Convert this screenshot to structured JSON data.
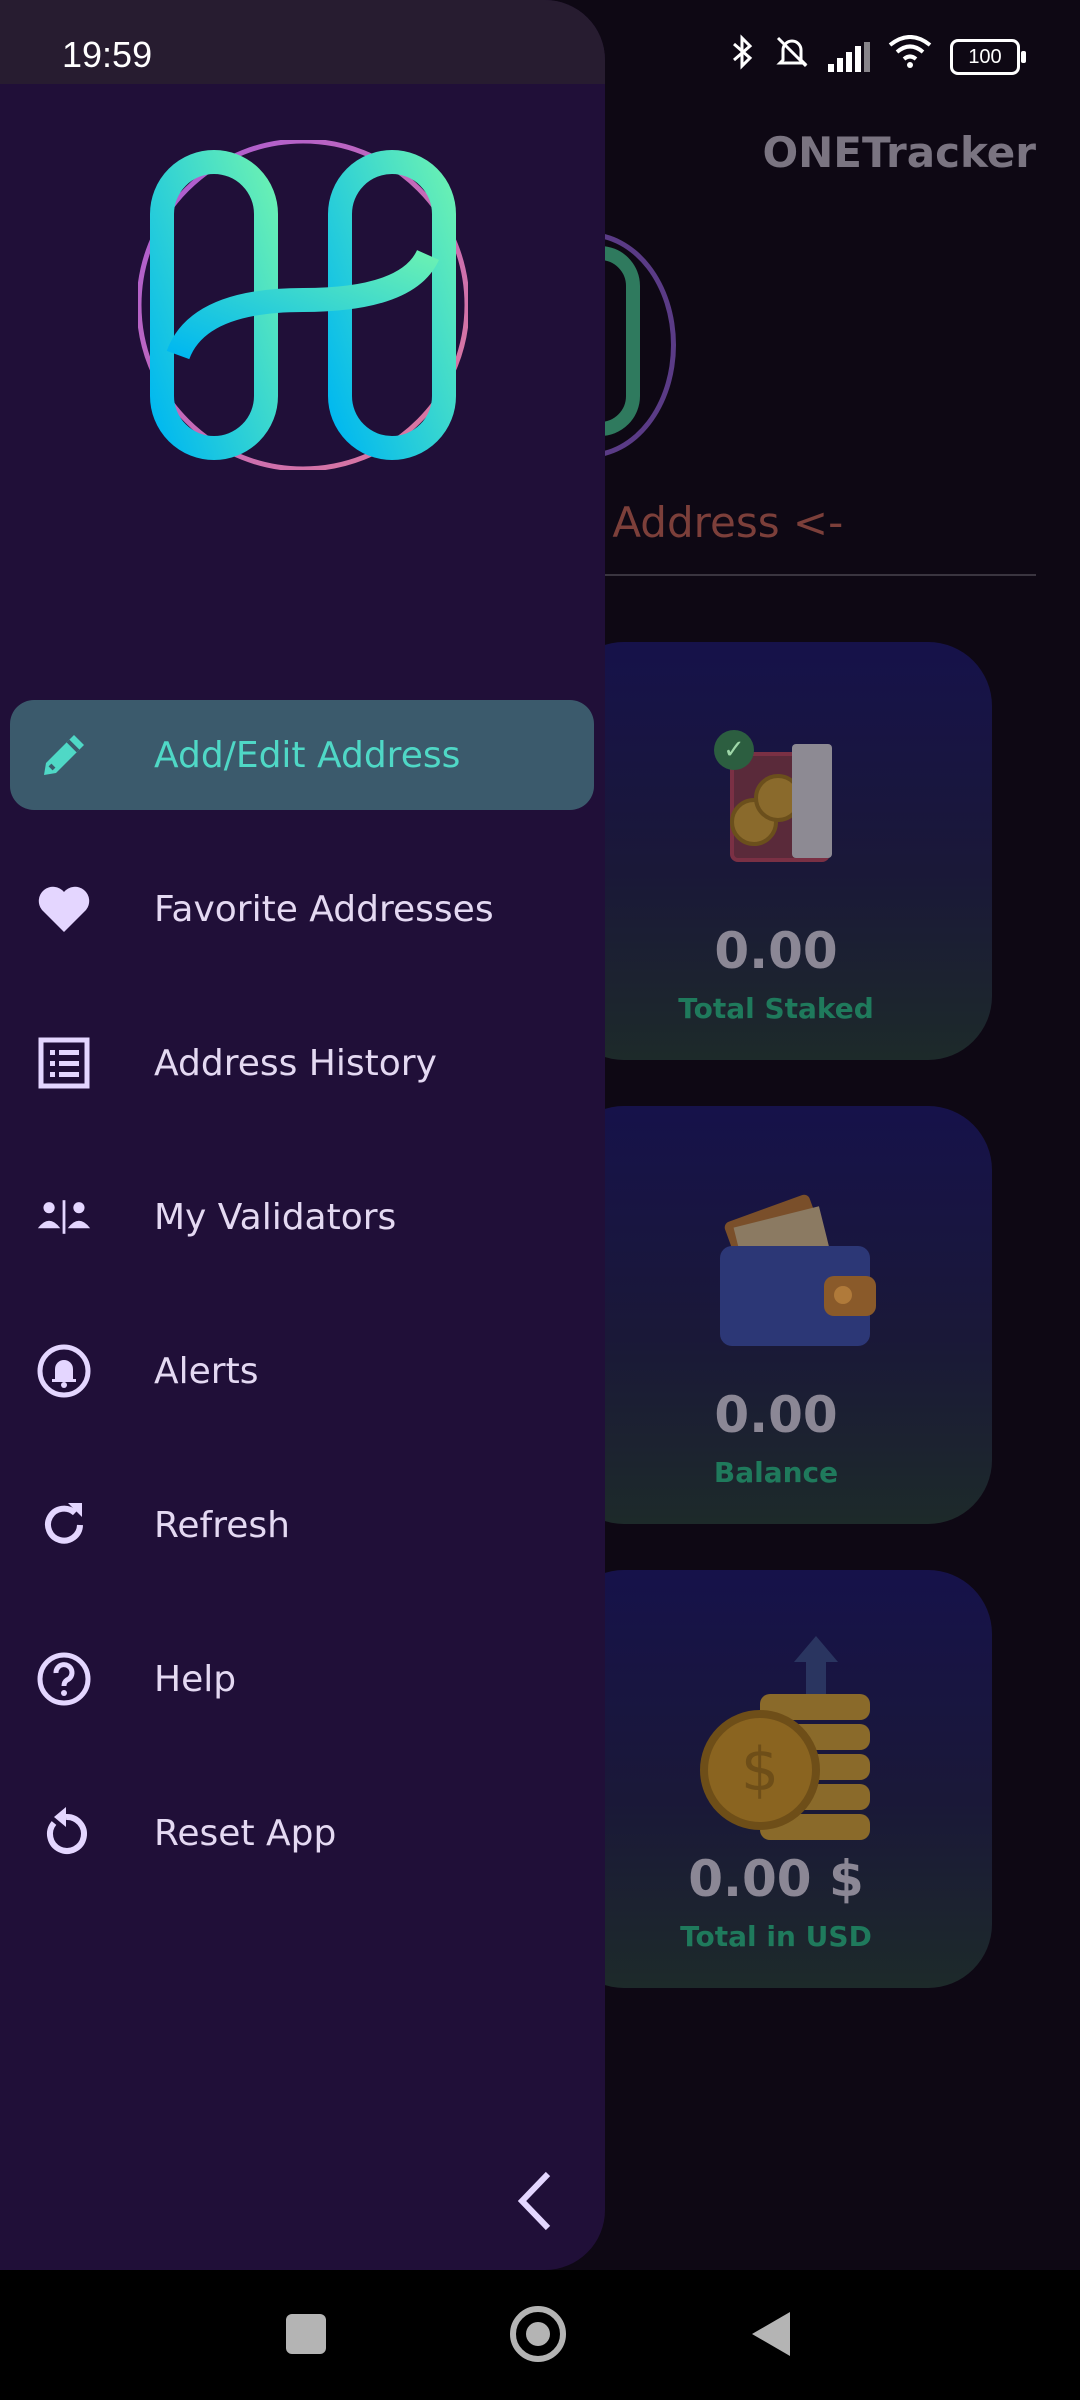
{
  "status_bar": {
    "time": "19:59",
    "battery": "100",
    "icons": [
      "bluetooth-icon",
      "bell-off-icon",
      "signal-icon",
      "wifi-icon",
      "battery-icon"
    ]
  },
  "app": {
    "title": "ONETracker",
    "address_prompt": "Set Address <-",
    "cards": [
      {
        "value": "0.00",
        "caption": "Total Staked",
        "icon": "vault-icon"
      },
      {
        "value": "0.00",
        "caption": "Balance",
        "icon": "wallet-icon"
      },
      {
        "value": "0.00 $",
        "caption": "Total in USD",
        "icon": "coins-icon"
      }
    ]
  },
  "drawer": {
    "logo": "harmony-logo",
    "menu": [
      {
        "label": "Add/Edit Address",
        "icon": "pencil-icon",
        "active": true
      },
      {
        "label": "Favorite Addresses",
        "icon": "heart-icon",
        "active": false
      },
      {
        "label": "Address History",
        "icon": "list-icon",
        "active": false
      },
      {
        "label": "My Validators",
        "icon": "people-icon",
        "active": false
      },
      {
        "label": "Alerts",
        "icon": "alarm-icon",
        "active": false
      },
      {
        "label": "Refresh",
        "icon": "refresh-icon",
        "active": false
      },
      {
        "label": "Help",
        "icon": "help-icon",
        "active": false
      },
      {
        "label": "Reset App",
        "icon": "reset-icon",
        "active": false
      }
    ],
    "collapse_icon": "chevron-left-icon"
  },
  "colors": {
    "drawer_bg": "#200f38",
    "active_item_bg": "#3b5a6c",
    "active_text": "#4fd8c6",
    "caption_green": "#1f7a5c"
  }
}
